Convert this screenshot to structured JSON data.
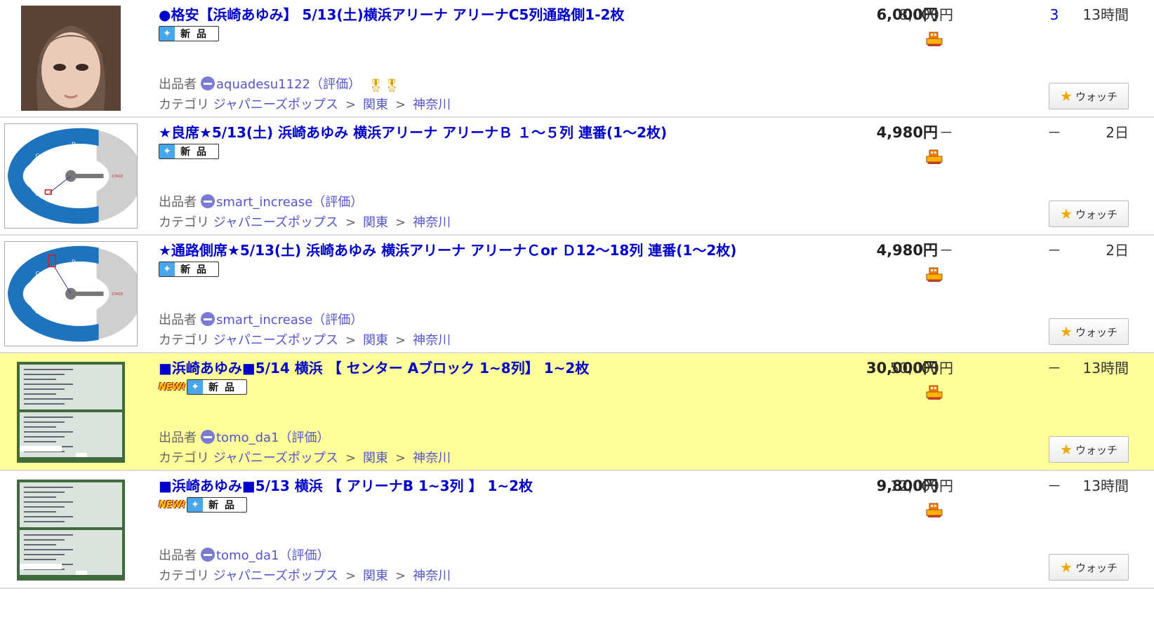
{
  "common": {
    "seller_label": "出品者",
    "rating_label": "（評価）",
    "category_label": "カテゴリ",
    "category_path": [
      "ジャパニーズポップス",
      "関東",
      "神奈川"
    ],
    "category_sep": ">",
    "watch_label": "ウォッチ",
    "shinpin_label": "新品",
    "new_label": "NEW!"
  },
  "colors": {
    "title_link": "#0000cc",
    "highlight_row": "#ffff99",
    "seller_link": "#5555cc",
    "watch_star": "#f0a800"
  },
  "items": [
    {
      "title": "●格安【浜崎あゆみ】 5/13(土)横浜アリーナ アリーナC5列通路側1-2枚",
      "thumb": "portrait-photo",
      "is_new": false,
      "highlighted": false,
      "seller": "aquadesu1122",
      "has_medal": true,
      "price": "6,000円",
      "buynow": "8,000円",
      "bids": "3",
      "time_left": "13時間"
    },
    {
      "title": "★良席★5/13(土) 浜崎あゆみ 横浜アリーナ アリーナＢ １～５列 連番(1～2枚)",
      "thumb": "seating-chart",
      "is_new": false,
      "highlighted": false,
      "seller": "smart_increase",
      "has_medal": false,
      "price": "4,980円",
      "buynow": "－",
      "bids": "－",
      "time_left": "2日"
    },
    {
      "title": "★通路側席★5/13(土) 浜崎あゆみ 横浜アリーナ アリーナＣor Ｄ12～18列 連番(1～2枚)",
      "thumb": "seating-chart",
      "is_new": false,
      "highlighted": false,
      "seller": "smart_increase",
      "has_medal": false,
      "price": "4,980円",
      "buynow": "－",
      "bids": "－",
      "time_left": "2日"
    },
    {
      "title": "■浜崎あゆみ■5/14 横浜 【 センター Aブロック 1~8列】 1~2枚",
      "thumb": "ticket-photo",
      "is_new": true,
      "highlighted": true,
      "seller": "tomo_da1",
      "has_medal": false,
      "price": "30,000円",
      "buynow": "50,000円",
      "bids": "－",
      "time_left": "13時間"
    },
    {
      "title": "■浜崎あゆみ■5/13 横浜 【 アリーナB 1~3列 】 1~2枚",
      "thumb": "ticket-photo",
      "is_new": true,
      "highlighted": false,
      "seller": "tomo_da1",
      "has_medal": false,
      "price": "9,800円",
      "buynow": "12,000円",
      "bids": "－",
      "time_left": "13時間"
    }
  ],
  "seat_blocks": [
    "A",
    "B",
    "C",
    "D"
  ],
  "stage_label": "STAGE"
}
